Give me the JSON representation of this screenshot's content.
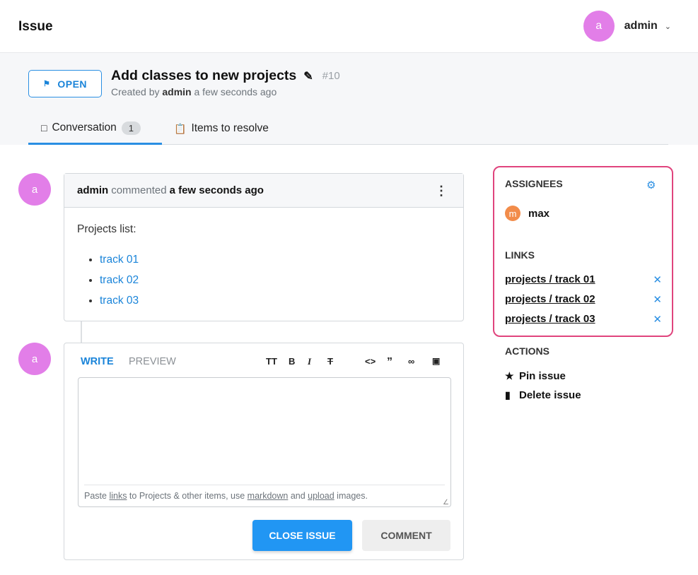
{
  "header": {
    "title": "Issue",
    "user": {
      "avatar_letter": "a",
      "name": "admin",
      "chevron": "chevron-down-icon"
    }
  },
  "issue": {
    "status": "OPEN",
    "status_icon": "flag-icon",
    "title": "Add classes to new projects",
    "number": "#10",
    "created_prefix": "Created by",
    "created_by": "admin",
    "created_when": "a few seconds ago"
  },
  "tabs": [
    {
      "label": "Conversation",
      "icon": "chat-icon",
      "count": "1"
    },
    {
      "label": "Items to resolve",
      "icon": "clipboard-icon"
    }
  ],
  "comment": {
    "avatar_letter": "a",
    "author": "admin",
    "verb": "commented",
    "when": "a few seconds ago",
    "intro": "Projects list:",
    "items": [
      "track 01",
      "track 02",
      "track 03"
    ]
  },
  "editor": {
    "avatar_letter": "a",
    "tab_write": "WRITE",
    "tab_preview": "PREVIEW",
    "toolbar": [
      "text-size-icon",
      "bold-icon",
      "italic-icon",
      "strikethrough-icon",
      "code-icon",
      "quote-icon",
      "link-icon",
      "image-icon"
    ],
    "hint": {
      "p1": "Paste ",
      "links": "links",
      "p2": " to Projects & other items, use ",
      "markdown": "markdown",
      "p3": " and ",
      "upload": "upload",
      "p4": " images."
    },
    "close_label": "CLOSE ISSUE",
    "comment_label": "COMMENT"
  },
  "sidebar": {
    "assignees_title": "ASSIGNEES",
    "assignee": {
      "letter": "m",
      "name": "max"
    },
    "links_title": "LINKS",
    "links": [
      "projects / track 01",
      "projects / track 02",
      "projects / track 03"
    ],
    "actions_title": "ACTIONS",
    "actions": [
      {
        "label": "Pin issue",
        "icon": "star-icon"
      },
      {
        "label": "Delete issue",
        "icon": "trash-icon"
      }
    ]
  },
  "colors": {
    "accent": "#2196f3",
    "avatar": "#e27ee8",
    "highlight_border": "#e0447d",
    "assignee_avatar": "#f28c4a"
  }
}
